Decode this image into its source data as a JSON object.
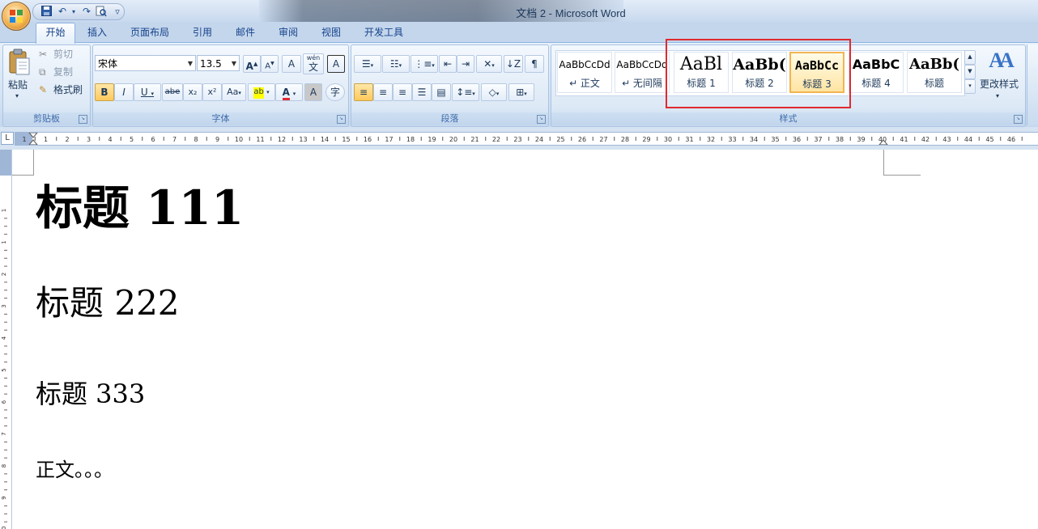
{
  "window": {
    "title": "文档 2 - Microsoft Word"
  },
  "quick_access": {
    "icons": [
      "save-icon",
      "undo-icon",
      "redo-icon",
      "print-preview-icon",
      "customize-icon"
    ],
    "undo": "↶",
    "redo": "↷",
    "more": "▿"
  },
  "tabs": [
    {
      "label": "开始",
      "active": true
    },
    {
      "label": "插入"
    },
    {
      "label": "页面布局"
    },
    {
      "label": "引用"
    },
    {
      "label": "邮件"
    },
    {
      "label": "审阅"
    },
    {
      "label": "视图"
    },
    {
      "label": "开发工具"
    }
  ],
  "clipboard": {
    "paste": "粘贴",
    "cut": "剪切",
    "copy": "复制",
    "format_painter": "格式刷",
    "group": "剪贴板"
  },
  "font": {
    "name": "宋体",
    "size": "13.5",
    "grow": "A",
    "shrink": "A",
    "clear": "A",
    "phonetic": "wén",
    "phonetic_sub": "文",
    "border": "A",
    "bold": "B",
    "italic": "I",
    "underline": "U",
    "strike": "abe",
    "subscript": "x₂",
    "superscript": "x²",
    "change_case": "Aa",
    "highlight": "ab",
    "color": "A",
    "shade": "A",
    "enclose": "字",
    "group": "字体"
  },
  "paragraph": {
    "group": "段落"
  },
  "styles": {
    "group": "样式",
    "items": [
      {
        "sample": "AaBbCcDd",
        "name": "↵ 正文"
      },
      {
        "sample": "AaBbCcDd",
        "name": "↵ 无间隔"
      },
      {
        "sample": "AaBl",
        "name": "标题 1"
      },
      {
        "sample": "AaBb(",
        "name": "标题 2"
      },
      {
        "sample": "AaBbCc",
        "name": "标题 3",
        "selected": true
      },
      {
        "sample": "AaBbC",
        "name": "标题 4"
      },
      {
        "sample": "AaBb(",
        "name": "标题"
      }
    ],
    "change_styles": "更改样式",
    "change_styles_icon": "AA"
  },
  "ruler": {
    "tab_selector": "L",
    "numbers": [
      "1",
      "1",
      "2",
      "3",
      "4",
      "5",
      "6",
      "7",
      "8",
      "9",
      "10",
      "11",
      "12",
      "13",
      "14",
      "15",
      "16",
      "17",
      "18",
      "19",
      "20",
      "21",
      "22",
      "23",
      "24",
      "25",
      "26",
      "27",
      "28",
      "29",
      "30",
      "31",
      "32",
      "33",
      "34",
      "35",
      "36",
      "37",
      "38",
      "39",
      "40",
      "41",
      "42",
      "43",
      "44",
      "45",
      "46"
    ],
    "vertical_numbers": [
      "1",
      "1",
      "2",
      "3",
      "4",
      "5",
      "6",
      "7",
      "8",
      "9",
      "10"
    ]
  },
  "document": {
    "heading1": "标题 111",
    "heading2": "标题 222",
    "heading3": "标题 333",
    "body": "正文。。。"
  },
  "colors": {
    "accent": "#15428b",
    "highlight_box": "#e0292f",
    "selected_style": "#ffe5a3"
  }
}
